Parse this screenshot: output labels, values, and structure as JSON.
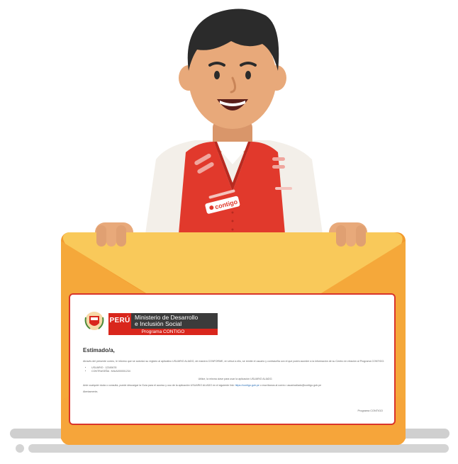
{
  "badge": {
    "label": "contigo"
  },
  "letter": {
    "country": "PERÚ",
    "ministry_line1": "Ministerio de Desarrollo",
    "ministry_line2": "e Inclusión Social",
    "program": "Programa CONTIGO",
    "greeting": "Estimado/a,",
    "paragraph1": "Através del presente correo, le informo que se autorizó su registro al aplicativo USUARIO ALIADO, de manera CONFORME, en virtud a ello, se remite el usuario y contraseña con el que podrá acceder a la información de su Centro en relación al Programa CONTIGO.",
    "bullets": [
      "USUARIO : 12345678",
      "CONTRASEÑA : MIUA000001234"
    ],
    "instructions": "Utilice, la misma clave para usar la aplicación USUARIO ALIADO.",
    "paragraph2_prefix": "Ante cualquier duda o consulta, puede descargar la Guía para el acceso y uso de la aplicación USUARIO ALIADO en el siguiente link:",
    "paragraph2_link": "https://contigo.gob.pe",
    "paragraph2_suffix": "o escríbanos al correo: usuarioaliado@contigo.gob.pe",
    "closing": "Atentamente,",
    "signature": "Programa CONTIGO"
  },
  "colors": {
    "vest_red": "#e1392c",
    "envelope_yellow": "#f9bb3b",
    "envelope_orange": "#f29a2e",
    "letter_border": "#d9342b",
    "skin": "#e8a97a",
    "hair": "#2b2b2b"
  }
}
